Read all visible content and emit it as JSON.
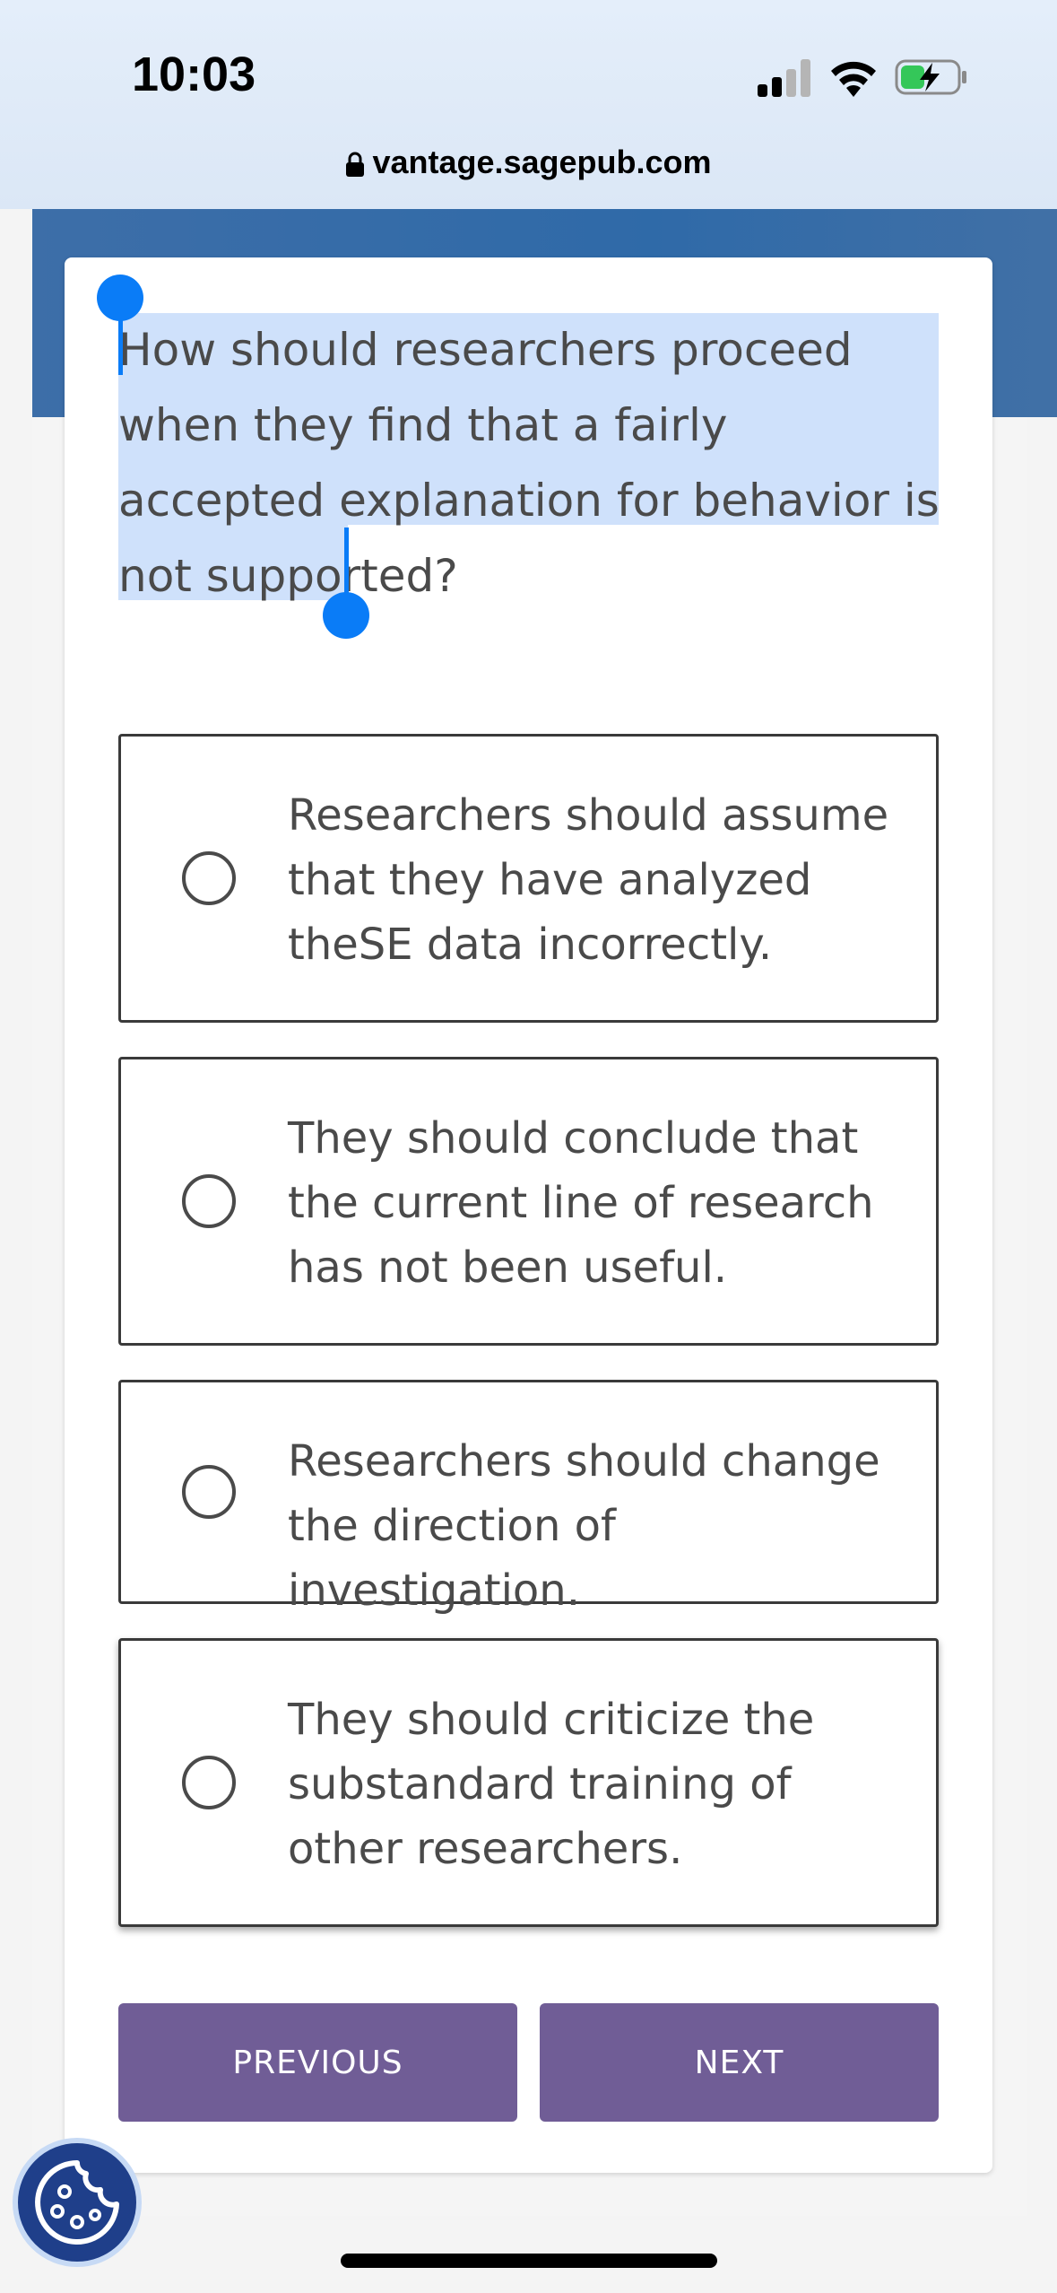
{
  "status_bar": {
    "time": "10:03",
    "signal_icon": "cellular-signal-icon",
    "wifi_icon": "wifi-icon",
    "battery_icon": "battery-charging-icon"
  },
  "browser": {
    "lock_icon": "lock-icon",
    "url": "vantage.sagepub.com"
  },
  "quiz": {
    "question": "How should researchers proceed when they find that a fairly accepted explanation for behavior is not supported?",
    "options": [
      {
        "text": "Researchers should assume that they have analyzed theSE data incorrectly."
      },
      {
        "text": "They should conclude that the current line of research has not been useful."
      },
      {
        "text": "Researchers should change the direction of investigation."
      },
      {
        "text": "They should criticize the substandard training of other researchers."
      }
    ],
    "previous_label": "PREVIOUS",
    "next_label": "NEXT"
  },
  "cookie": {
    "icon": "cookie-icon"
  },
  "colors": {
    "accent_button": "#705d96",
    "header_band": "#2f6aa8",
    "selection": "#cfe1fb",
    "selection_handle": "#0a7cf7"
  }
}
